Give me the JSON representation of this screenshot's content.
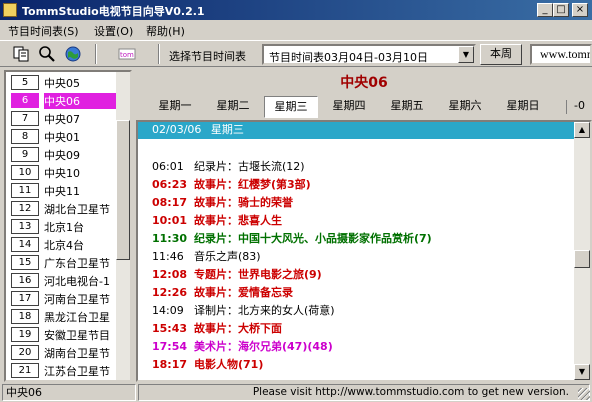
{
  "window": {
    "title": "TommStudio电视节目向导V0.2.1",
    "min": "_",
    "max": "□",
    "close": "×"
  },
  "menu": [
    "节目时间表(S)",
    "设置(O)",
    "帮助(H)"
  ],
  "toolbar": {
    "select_label": "选择节目时间表",
    "schedule_value": "节目时间表03月04日-03月10日",
    "this_week": "本周",
    "url": "www.tomm"
  },
  "channels": [
    {
      "num": "5",
      "name": "中央05"
    },
    {
      "num": "6",
      "name": "中央06",
      "selected": true
    },
    {
      "num": "7",
      "name": "中央07"
    },
    {
      "num": "8",
      "name": "中央01"
    },
    {
      "num": "9",
      "name": "中央09"
    },
    {
      "num": "10",
      "name": "中央10"
    },
    {
      "num": "11",
      "name": "中央11"
    },
    {
      "num": "12",
      "name": "湖北台卫星节"
    },
    {
      "num": "13",
      "name": "北京1台"
    },
    {
      "num": "14",
      "name": "北京4台"
    },
    {
      "num": "15",
      "name": "广东台卫星节"
    },
    {
      "num": "16",
      "name": "河北电视台-1"
    },
    {
      "num": "17",
      "name": "河南台卫星节"
    },
    {
      "num": "18",
      "name": "黑龙江台卫星"
    },
    {
      "num": "19",
      "name": "安徽卫星节目"
    },
    {
      "num": "20",
      "name": "湖南台卫星节"
    },
    {
      "num": "21",
      "name": "江苏台卫星节"
    }
  ],
  "main": {
    "channel_title": "中央06",
    "days": [
      "星期一",
      "星期二",
      "星期三",
      "星期四",
      "星期五",
      "星期六",
      "星期日"
    ],
    "active_day": 2,
    "day_more": "-0",
    "date_header": {
      "date": "02/03/06",
      "weekday": "星期三"
    },
    "programs": [
      {
        "time": "06:01",
        "title": "纪录片：古堰长流(12)",
        "color": "#000000",
        "bold": false
      },
      {
        "time": "06:23",
        "title": "故事片：红樱梦(第3部)",
        "color": "#cc0000",
        "bold": true
      },
      {
        "time": "08:17",
        "title": "故事片：骑士的荣誉",
        "color": "#cc0000",
        "bold": true
      },
      {
        "time": "10:01",
        "title": "故事片：悲喜人生",
        "color": "#cc0000",
        "bold": true
      },
      {
        "time": "11:30",
        "title": "纪录片：中国十大风光、小品摄影家作品赏析(7)",
        "color": "#007000",
        "bold": true
      },
      {
        "time": "11:46",
        "title": "音乐之声(83)",
        "color": "#000000",
        "bold": false
      },
      {
        "time": "12:08",
        "title": "专题片：世界电影之旅(9)",
        "color": "#cc0000",
        "bold": true
      },
      {
        "time": "12:26",
        "title": "故事片：爱情备忘录",
        "color": "#cc0000",
        "bold": true
      },
      {
        "time": "14:09",
        "title": "译制片：北方来的女人(荷意)",
        "color": "#000000",
        "bold": false
      },
      {
        "time": "15:43",
        "title": "故事片：大桥下面",
        "color": "#cc0000",
        "bold": true
      },
      {
        "time": "17:54",
        "title": "美术片：海尔兄弟(47)(48)",
        "color": "#cc00cc",
        "bold": true
      },
      {
        "time": "18:17",
        "title": "电影人物(71)",
        "color": "#cc0000",
        "bold": true
      }
    ]
  },
  "status": {
    "left": "中央06",
    "right": "Please visit http://www.tommstudio.com  to get new version."
  }
}
